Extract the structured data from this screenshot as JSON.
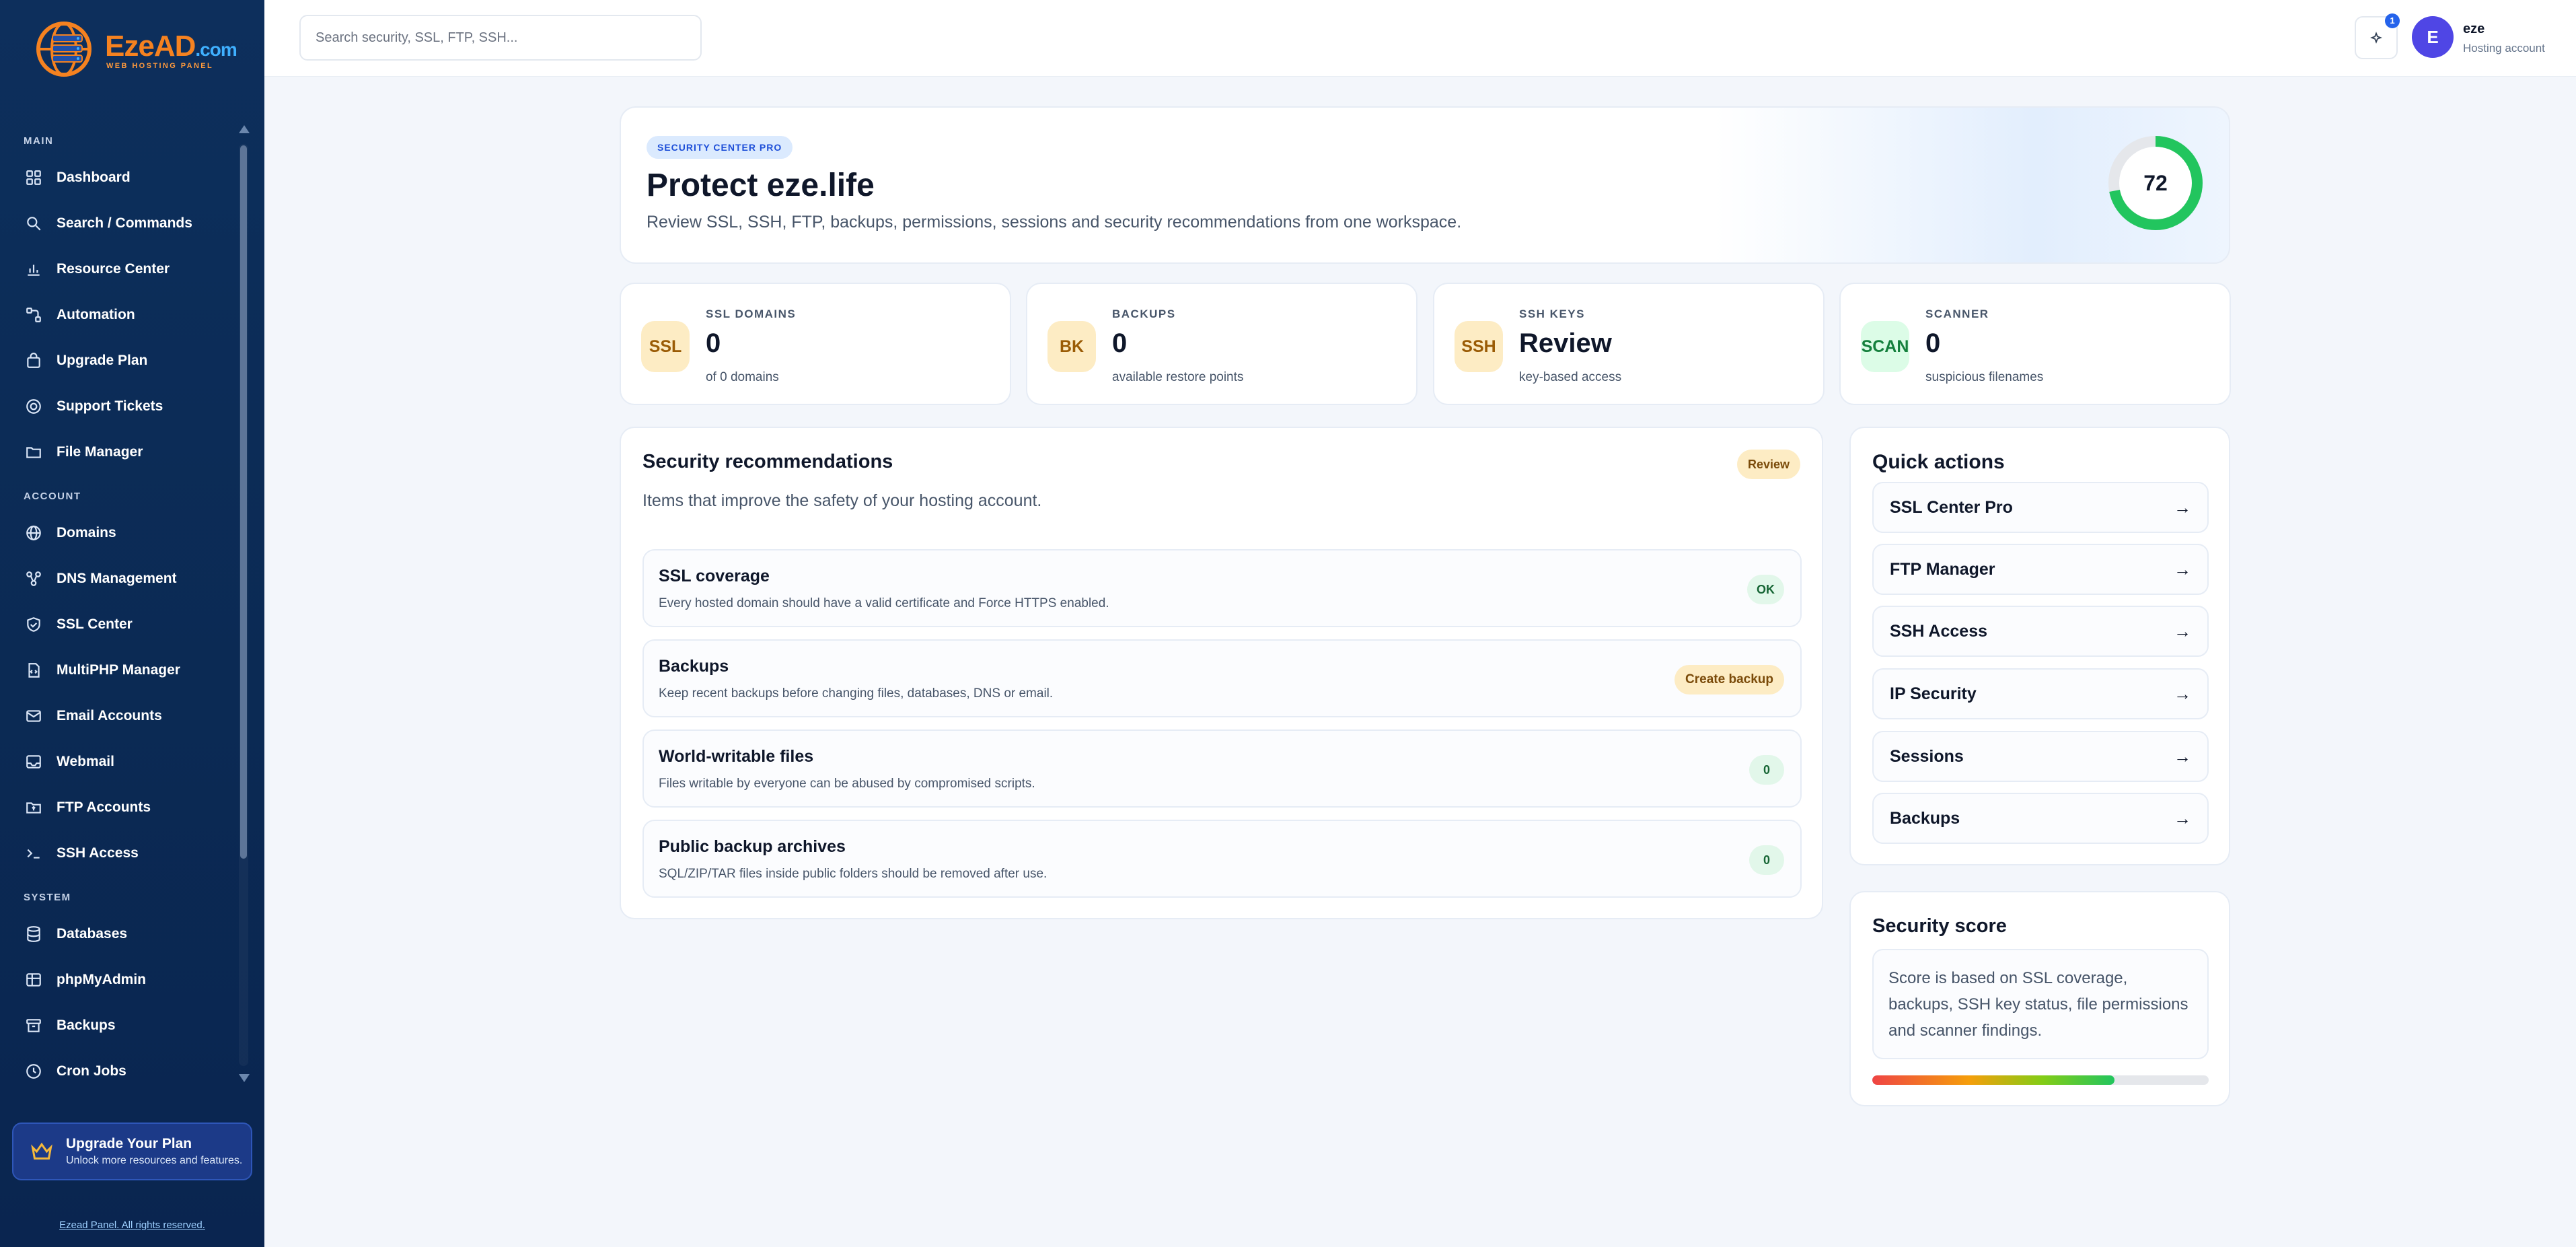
{
  "sidebar": {
    "brand": {
      "name_part1": "Eze",
      "name_part2": "AD",
      "suffix": ".com",
      "tagline": "WEB HOSTING PANEL"
    },
    "sections": [
      {
        "label": "MAIN",
        "items": [
          {
            "label": "Dashboard",
            "icon": "grid-icon"
          },
          {
            "label": "Search / Commands",
            "icon": "search-icon"
          },
          {
            "label": "Resource Center",
            "icon": "bar-chart-icon"
          },
          {
            "label": "Automation",
            "icon": "workflow-icon"
          },
          {
            "label": "Upgrade Plan",
            "icon": "bag-icon"
          },
          {
            "label": "Support Tickets",
            "icon": "lifebuoy-icon"
          },
          {
            "label": "File Manager",
            "icon": "folder-icon"
          }
        ]
      },
      {
        "label": "ACCOUNT",
        "items": [
          {
            "label": "Domains",
            "icon": "globe-icon"
          },
          {
            "label": "DNS Management",
            "icon": "network-icon"
          },
          {
            "label": "SSL Center",
            "icon": "shield-check-icon"
          },
          {
            "label": "MultiPHP Manager",
            "icon": "file-code-icon"
          },
          {
            "label": "Email Accounts",
            "icon": "mail-icon"
          },
          {
            "label": "Webmail",
            "icon": "inbox-icon"
          },
          {
            "label": "FTP Accounts",
            "icon": "folder-upload-icon"
          },
          {
            "label": "SSH Access",
            "icon": "terminal-icon"
          }
        ]
      },
      {
        "label": "SYSTEM",
        "items": [
          {
            "label": "Databases",
            "icon": "database-icon"
          },
          {
            "label": "phpMyAdmin",
            "icon": "table-icon"
          },
          {
            "label": "Backups",
            "icon": "archive-icon"
          },
          {
            "label": "Cron Jobs",
            "icon": "clock-icon"
          }
        ]
      }
    ],
    "upgrade": {
      "title": "Upgrade Your Plan",
      "subtitle": "Unlock more resources and features."
    },
    "footer": "Ezead Panel. All rights reserved."
  },
  "topbar": {
    "search_placeholder": "Search security, SSL, FTP, SSH...",
    "notifications_count": "1",
    "avatar_initial": "E",
    "user_name": "eze",
    "user_role": "Hosting account"
  },
  "hero": {
    "pill": "SECURITY CENTER PRO",
    "title": "Protect eze.life",
    "description": "Review SSL, SSH, FTP, backups, permissions, sessions and security recommendations from one workspace.",
    "score": "72",
    "score_fraction": 0.72
  },
  "stats": [
    {
      "badge": "SSL",
      "label": "SSL DOMAINS",
      "value": "0",
      "sub": "of 0 domains"
    },
    {
      "badge": "BK",
      "label": "BACKUPS",
      "value": "0",
      "sub": "available restore points"
    },
    {
      "badge": "SSH",
      "label": "SSH KEYS",
      "value": "Review",
      "sub": "key-based access"
    },
    {
      "badge": "SCAN",
      "label": "SCANNER",
      "value": "0",
      "sub": "suspicious filenames"
    }
  ],
  "recommendations": {
    "title": "Security recommendations",
    "status": "Review",
    "intro": "Items that improve the safety of your hosting account.",
    "items": [
      {
        "title": "SSL coverage",
        "desc": "Every hosted domain should have a valid certificate and Force HTTPS enabled.",
        "status": "OK"
      },
      {
        "title": "Backups",
        "desc": "Keep recent backups before changing files, databases, DNS or email.",
        "action": "Create backup"
      },
      {
        "title": "World-writable files",
        "desc": "Files writable by everyone can be abused by compromised scripts.",
        "status": "0"
      },
      {
        "title": "Public backup archives",
        "desc": "SQL/ZIP/TAR files inside public folders should be removed after use.",
        "status": "0"
      }
    ]
  },
  "quick_actions": {
    "title": "Quick actions",
    "items": [
      "SSL Center Pro",
      "FTP Manager",
      "SSH Access",
      "IP Security",
      "Sessions",
      "Backups"
    ],
    "arrow": "→"
  },
  "security_score": {
    "title": "Security score",
    "description": "Score is based on SSL coverage, backups, SSH key status, file permissions and scanner findings.",
    "fraction": 0.72
  },
  "colors": {
    "sidebar_bg": "#0b2a54",
    "accent_blue": "#2563eb",
    "ring_green": "#22c55e",
    "ssl_badge_bg": "#fdecc4",
    "scan_badge_bg": "#dcfce7"
  }
}
